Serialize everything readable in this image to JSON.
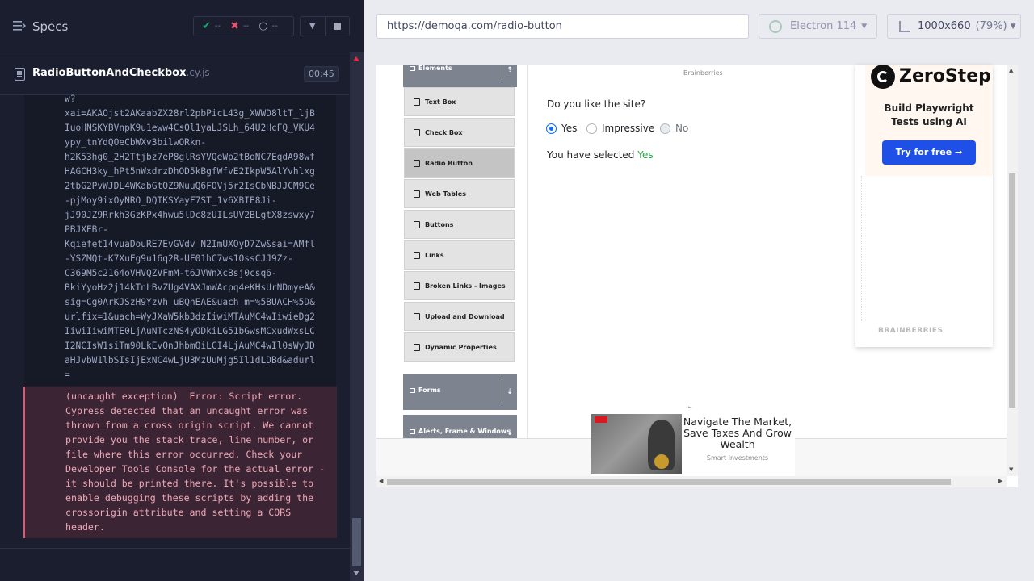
{
  "runner": {
    "specs_label": "Specs",
    "stats": {
      "passed": "--",
      "failed": "--",
      "pending": "--"
    },
    "spec_file": {
      "name": "RadioButtonAndCheckbox",
      "ext": ".cy.js",
      "duration": "00:45"
    },
    "log_url": "w?\nxai=AKAOjst2AKaabZX28rl2pbPicL43g_XWWD8ltT_ljB\nIuoHNSKYBVnpK9u1eww4CsOl1yaLJSLh_64U2HcFQ_VKU4\nypy_tnYdQOeCbWXv3bilwORkn-\nh2K53hg0_2H2Ttjbz7eP8glRsYVQeWp2tBoNC7EqdA98wf\nHAGCH3ky_hPt5nWxdrzDhOD5kBgfWfvE2IkpW5AlYvhlxg\n2tbG2PvWJDL4WKabGtOZ9NuuQ6FOVj5r2IsCbNBJJCM9Ce\n-pjMoy9ixOyNRO_DQTKSYayF7ST_1v6XBIE8Ji-\njJ90JZ9Rrkh3GzKPx4hwu5lDc8zUILsUV2BLgtX8zswxy7\nPBJXEBr-\nKqiefet14vuaDouRE7EvGVdv_N2ImUXOyD7Zw&sai=AMfl\n-YSZMQt-K7XuFg9u16q2R-UF01hC7ws1OssCJJ9Zz-\nC369M5c2164oVHVQZVFmM-t6JVWnXcBsj0csq6-\nBkiYyoHz2j14kTnLBvZUg4VAXJmWAcpq4eKHsUrNDmyeA&\nsig=Cg0ArKJSzH9YzVh_uBQnEAE&uach_m=%5BUACH%5D&\nurlfix=1&uach=WyJXaW5kb3dzIiwiMTAuMC4wIiwieDg2\nIiwiIiwiMTE0LjAuNTczNS4yODkiLG51bGwsMCxudWxsLC\nI2NCIsW1siTm90LkEvQnJhbmQiLCI4LjAuMC4wIl0sWyJD\naHJvbW1lbSIsIjExNC4wLjU3MzUuMjg5Il1dLDBd&adurl\n=",
    "error_text": "(uncaught exception)  Error: Script error.\nCypress detected that an uncaught error was\nthrown from a cross origin script. We cannot\nprovide you the stack trace, line number, or\nfile where this error occurred. Check your\nDeveloper Tools Console for the actual error -\nit should be printed there. It's possible to\nenable debugging these scripts by adding the\ncrossorigin attribute and setting a CORS\nheader."
  },
  "preview": {
    "url": "https://demoqa.com/radio-button",
    "browser": "Electron 114",
    "viewport": "1000x660",
    "scale": "(79%)"
  },
  "demoqa": {
    "groups": {
      "elements": "Elements",
      "forms": "Forms",
      "alerts": "Alerts, Frame & Windows"
    },
    "menu": [
      "Text Box",
      "Check Box",
      "Radio Button",
      "Web Tables",
      "Buttons",
      "Links",
      "Broken Links - Images",
      "Upload and Download",
      "Dynamic Properties"
    ],
    "brainberries_top": "Brainberries",
    "question": "Do you like the site?",
    "options": {
      "yes": "Yes",
      "impressive": "Impressive",
      "no": "No"
    },
    "selected_prefix": "You have selected ",
    "selected_value": "Yes"
  },
  "ads": {
    "zerostep_name": "ZeroStep",
    "zerostep_tagline": "Build Playwright Tests using AI",
    "zerostep_button": "Try for free →",
    "brainberries_label": "BRAINBERRIES",
    "bottom_title": "Navigate The Market, Save Taxes And Grow Wealth",
    "bottom_source": "Smart Investments"
  },
  "colors": {
    "accent_pass": "#1fa971",
    "accent_fail": "#e45770",
    "selected_green": "#28a745",
    "radio_blue": "#0d6efd"
  },
  "icons": [
    "specs-icon",
    "check-icon",
    "x-icon",
    "spinner-icon",
    "chevron-down-icon",
    "stop-icon",
    "file-icon",
    "electron-icon",
    "viewport-icon",
    "doc-icon"
  ]
}
